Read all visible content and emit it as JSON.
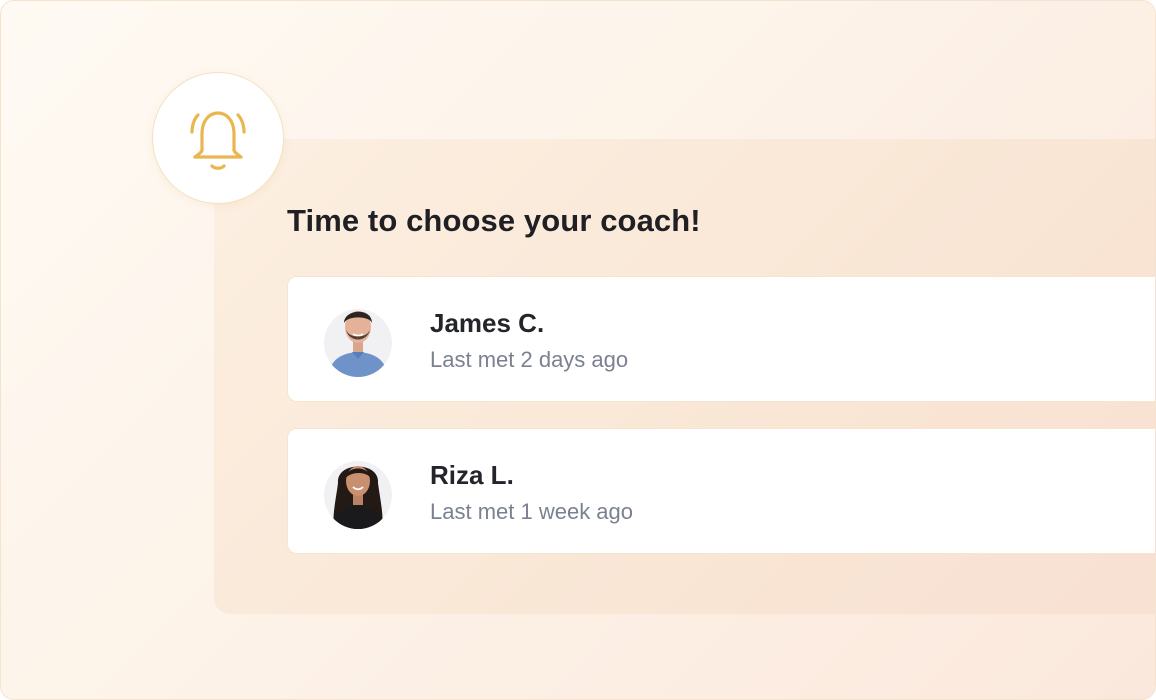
{
  "notification": {
    "icon": "bell-icon",
    "title": "Time to choose your coach!"
  },
  "coaches": [
    {
      "name": "James C.",
      "last_met": "Last met 2 days ago",
      "avatar": "man-avatar"
    },
    {
      "name": "Riza L.",
      "last_met": "Last met 1 week ago",
      "avatar": "woman-avatar"
    }
  ],
  "colors": {
    "accent": "#E9B64F",
    "title_text": "#1F1F24",
    "meta_text": "#7B8190",
    "panel_bg": "#F9E7D6"
  }
}
